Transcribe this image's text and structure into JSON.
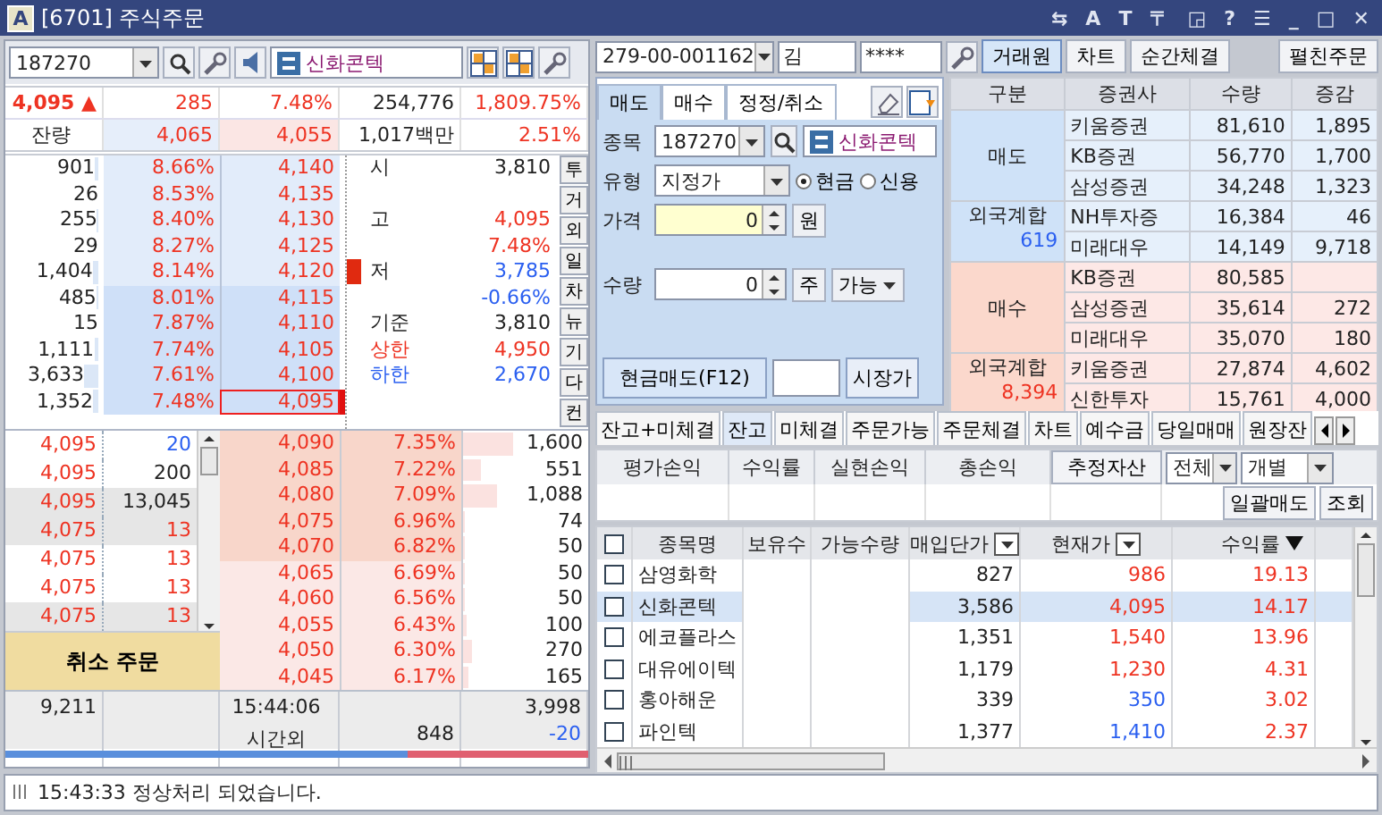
{
  "window": {
    "badge": "A",
    "title": "[6701] 주식주문",
    "tools": [
      "⇆",
      "A",
      "T",
      "〒",
      "◲",
      "?",
      "☰",
      "_",
      "□",
      "✕"
    ]
  },
  "left": {
    "code": "187270",
    "stock_name": "신화콘텍",
    "quote": [
      {
        "text": "4,095 ▲",
        "color": "#ee3322"
      },
      {
        "text": "285",
        "color": "#ee3322"
      },
      {
        "text": "7.48%",
        "color": "#ee3322"
      },
      {
        "text": "254,776",
        "color": "#222222"
      },
      {
        "text": "1,809.75%",
        "color": "#ee3322"
      }
    ],
    "remain": [
      {
        "text": "잔량",
        "color": "#222222",
        "kind": "label"
      },
      {
        "text": "4,065",
        "color": "#ee3322",
        "kind": "sell"
      },
      {
        "text": "4,055",
        "color": "#ee3322",
        "kind": "buy"
      },
      {
        "text": "1,017백만",
        "color": "#222222",
        "kind": "plain"
      },
      {
        "text": "2.51%",
        "color": "#ee3322",
        "kind": "plain"
      }
    ],
    "asks": [
      {
        "qty": "901",
        "pct": "8.66%",
        "price": "4,140",
        "current": false
      },
      {
        "qty": "26",
        "pct": "8.53%",
        "price": "4,135",
        "current": false
      },
      {
        "qty": "255",
        "pct": "8.40%",
        "price": "4,130",
        "current": false
      },
      {
        "qty": "29",
        "pct": "8.27%",
        "price": "4,125",
        "current": false
      },
      {
        "qty": "1,404",
        "pct": "8.14%",
        "price": "4,120",
        "current": false
      },
      {
        "qty": "485",
        "pct": "8.01%",
        "price": "4,115",
        "current": false
      },
      {
        "qty": "15",
        "pct": "7.87%",
        "price": "4,110",
        "current": false
      },
      {
        "qty": "1,111",
        "pct": "7.74%",
        "price": "4,105",
        "current": false
      },
      {
        "qty": "3,633",
        "pct": "7.61%",
        "price": "4,100",
        "current": false
      },
      {
        "qty": "1,352",
        "pct": "7.48%",
        "price": "4,095",
        "current": true
      }
    ],
    "info": [
      {
        "label": "시",
        "value": "3,810",
        "color": "#222222"
      },
      {
        "label": "고",
        "value": "4,095",
        "color": "#ee3322",
        "spaced": true
      },
      {
        "value": "7.48%",
        "color": "#ee3322"
      },
      {
        "label": "저",
        "value": "3,785",
        "color": "#2a5ff0"
      },
      {
        "value": "-0.66%",
        "color": "#2a5ff0"
      },
      {
        "label": "기준",
        "value": "3,810",
        "color": "#222222"
      },
      {
        "label": "상한",
        "value": "4,950",
        "color": "#ee3322",
        "label_colored": true
      },
      {
        "label": "하한",
        "value": "2,670",
        "color": "#2a5ff0",
        "label_colored": true
      }
    ],
    "side_buttons": [
      "투",
      "거",
      "외",
      "일",
      "차",
      "뉴",
      "기",
      "다",
      "컨"
    ],
    "ticks": [
      {
        "price": "4,095",
        "qty": "20",
        "color": "#2a5ff0"
      },
      {
        "price": "4,095",
        "qty": "200",
        "color": "#222222"
      },
      {
        "price": "4,095",
        "qty": "13,045",
        "color": "#222222"
      },
      {
        "price": "4,075",
        "qty": "13",
        "color": "#ee3322"
      },
      {
        "price": "4,075",
        "qty": "13",
        "color": "#ee3322"
      },
      {
        "price": "4,075",
        "qty": "13",
        "color": "#ee3322"
      },
      {
        "price": "4,075",
        "qty": "13",
        "color": "#ee3322"
      }
    ],
    "cancel_button": "취소 주문",
    "bids": [
      {
        "price": "4,090",
        "pct": "7.35%",
        "qty": "1,600"
      },
      {
        "price": "4,085",
        "pct": "7.22%",
        "qty": "551"
      },
      {
        "price": "4,080",
        "pct": "7.09%",
        "qty": "1,088"
      },
      {
        "price": "4,075",
        "pct": "6.96%",
        "qty": "74"
      },
      {
        "price": "4,070",
        "pct": "6.82%",
        "qty": "50"
      },
      {
        "price": "4,065",
        "pct": "6.69%",
        "qty": "50"
      },
      {
        "price": "4,060",
        "pct": "6.56%",
        "qty": "50"
      },
      {
        "price": "4,055",
        "pct": "6.43%",
        "qty": "100"
      },
      {
        "price": "4,050",
        "pct": "6.30%",
        "qty": "270"
      },
      {
        "price": "4,045",
        "pct": "6.17%",
        "qty": "165"
      }
    ],
    "footer": {
      "ask_total": "9,211",
      "time": "15:44:06",
      "session": "시간외",
      "after_qty": "848",
      "bid_total": "3,998",
      "after_change": "-20"
    },
    "ratio": {
      "level": 0.69
    }
  },
  "right": {
    "account": {
      "number": "279-00-001162",
      "name": "김",
      "password": "****"
    },
    "views": [
      {
        "label": "거래원",
        "selected": true
      },
      {
        "label": "차트",
        "selected": false
      },
      {
        "label": "순간체결",
        "selected": false
      }
    ],
    "expand_button": "펼친주문",
    "order": {
      "tabs": [
        {
          "label": "매도",
          "selected": true
        },
        {
          "label": "매수",
          "selected": false
        },
        {
          "label": "정정/취소",
          "selected": false
        }
      ],
      "code_label": "종목",
      "code": "187270",
      "stock_name": "신화콘텍",
      "type_label": "유형",
      "type": "지정가",
      "credit_options": [
        {
          "label": "현금",
          "selected": true
        },
        {
          "label": "신용",
          "selected": false
        }
      ],
      "price_label": "가격",
      "price": "0",
      "price_unit": "원",
      "qty_label": "수량",
      "qty": "0",
      "qty_unit": "주",
      "qty_mode": "가능",
      "submit": "현금매도(F12)",
      "market_button": "시장가"
    },
    "brokers": {
      "columns": [
        "구분",
        "증권사",
        "수량",
        "증감"
      ],
      "groups": [
        {
          "kind": "sell",
          "label": "매도",
          "foreign_label": "외국계합",
          "foreign_value": "619",
          "rows": [
            {
              "broker": "키움증권",
              "qty": "81,610",
              "change": "1,895"
            },
            {
              "broker": "KB증권",
              "qty": "56,770",
              "change": "1,700"
            },
            {
              "broker": "삼성증권",
              "qty": "34,248",
              "change": "1,323"
            },
            {
              "broker": "NH투자증",
              "qty": "16,384",
              "change": "46"
            },
            {
              "broker": "미래대우",
              "qty": "14,149",
              "change": "9,718"
            }
          ]
        },
        {
          "kind": "buy",
          "label": "매수",
          "foreign_label": "외국계합",
          "foreign_value": "8,394",
          "rows": [
            {
              "broker": "KB증권",
              "qty": "80,585"
            },
            {
              "broker": "삼성증권",
              "qty": "35,614",
              "change": "272"
            },
            {
              "broker": "미래대우",
              "qty": "35,070",
              "change": "180"
            },
            {
              "broker": "키움증권",
              "qty": "27,874",
              "change": "4,602"
            },
            {
              "broker": "신한투자",
              "qty": "15,761",
              "change": "4,000"
            }
          ]
        }
      ]
    },
    "tabs": [
      {
        "label": "잔고+미체결",
        "selected": false
      },
      {
        "label": "잔고",
        "selected": true
      },
      {
        "label": "미체결",
        "selected": false
      },
      {
        "label": "주문가능",
        "selected": false
      },
      {
        "label": "주문체결",
        "selected": false
      },
      {
        "label": "차트",
        "selected": false
      },
      {
        "label": "예수금",
        "selected": false
      },
      {
        "label": "당일매매",
        "selected": false
      },
      {
        "label": "원장잔",
        "selected": false
      }
    ],
    "summary": {
      "columns": [
        "평가손익",
        "수익률",
        "실현손익",
        "총손익"
      ],
      "asset_button": "추정자산",
      "filters": [
        "전체",
        "개별"
      ],
      "buttons": [
        "일괄매도",
        "조회"
      ]
    },
    "holdings": {
      "all_checked": false,
      "columns": [
        {
          "label": "종목명",
          "kind": "plain"
        },
        {
          "label": "보유수",
          "kind": "plain"
        },
        {
          "label": "가능수량",
          "kind": "plain"
        },
        {
          "label": "매입단가",
          "kind": "dropdown"
        },
        {
          "label": "현재가",
          "kind": "dropdown"
        },
        {
          "label": "수익률",
          "kind": "sort"
        }
      ],
      "rows": [
        {
          "name": "삼영화학",
          "checked": false,
          "selected": false,
          "avg_price": "827",
          "price": "986",
          "color": "#ee3322",
          "return": "19.13"
        },
        {
          "name": "신화콘텍",
          "checked": false,
          "selected": true,
          "avg_price": "3,586",
          "price": "4,095",
          "color": "#ee3322",
          "return": "14.17"
        },
        {
          "name": "에코플라스",
          "checked": false,
          "selected": false,
          "avg_price": "1,351",
          "price": "1,540",
          "color": "#ee3322",
          "return": "13.96"
        },
        {
          "name": "대유에이텍",
          "checked": false,
          "selected": false,
          "avg_price": "1,179",
          "price": "1,230",
          "color": "#ee3322",
          "return": "4.31"
        },
        {
          "name": "홍아해운",
          "checked": false,
          "selected": false,
          "avg_price": "339",
          "price": "350",
          "color": "#2a5ff0",
          "return": "3.02"
        },
        {
          "name": "파인텍",
          "checked": false,
          "selected": false,
          "avg_price": "1,377",
          "price": "1,410",
          "color": "#2a5ff0",
          "return": "2.37"
        }
      ]
    }
  },
  "status": {
    "message": "15:43:33 정상처리 되었습니다."
  }
}
